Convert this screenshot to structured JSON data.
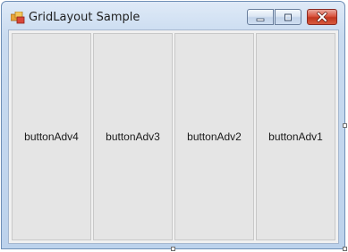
{
  "window": {
    "title": "GridLayout Sample",
    "icon": "windows-forms-app-icon"
  },
  "caption_buttons": [
    {
      "name": "minimize",
      "icon": "minimize-icon"
    },
    {
      "name": "maximize",
      "icon": "maximize-icon"
    },
    {
      "name": "close",
      "icon": "close-icon"
    }
  ],
  "grid": {
    "buttons": [
      {
        "label": "buttonAdv4"
      },
      {
        "label": "buttonAdv3"
      },
      {
        "label": "buttonAdv2"
      },
      {
        "label": "buttonAdv1"
      }
    ]
  },
  "colors": {
    "button_face": "#e5e5e5",
    "button_border": "#c8c8c8",
    "close_red": "#c1361f",
    "frame_blue": "#bcd2ec"
  }
}
